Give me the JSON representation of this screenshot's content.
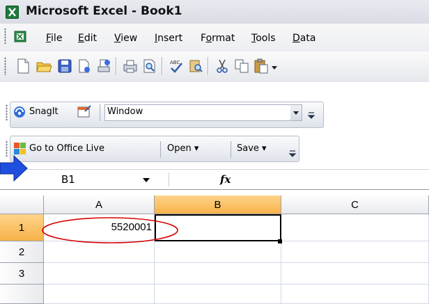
{
  "title_bar": {
    "title": "Microsoft Excel - Book1"
  },
  "menu": {
    "items": [
      {
        "label": "File",
        "underline": "F",
        "rest": "ile"
      },
      {
        "label": "Edit",
        "underline": "E",
        "rest": "dit"
      },
      {
        "label": "View",
        "underline": "V",
        "rest": "iew"
      },
      {
        "label": "Insert",
        "underline": "I",
        "rest": "nsert"
      },
      {
        "label": "Format",
        "pre": "F",
        "underline": "o",
        "rest": "rmat"
      },
      {
        "label": "Tools",
        "underline": "T",
        "rest": "ools"
      },
      {
        "label": "Data",
        "underline": "D",
        "rest": "ata"
      }
    ]
  },
  "standard_toolbar": {
    "icons": [
      "new-icon",
      "open-icon",
      "save-icon",
      "permission-icon",
      "print-area-icon",
      "print-icon",
      "print-preview-icon",
      "spelling-icon",
      "research-icon",
      "cut-icon",
      "copy-icon",
      "paste-icon"
    ]
  },
  "snagit_toolbar": {
    "label": "SnagIt",
    "combo_value": "Window"
  },
  "office_live_toolbar": {
    "go_label": "Go to Office Live",
    "open_label": "Open ▾",
    "save_label": "Save ▾"
  },
  "formula_bar": {
    "name_box": "B1",
    "fx": "fx",
    "formula": ""
  },
  "grid": {
    "columns": [
      "A",
      "B",
      "C"
    ],
    "rows": [
      "1",
      "2",
      "3"
    ],
    "cells": {
      "A1": "5520001",
      "B1": ""
    },
    "active_cell": "B1"
  },
  "colors": {
    "selected_header": "#f7b24a",
    "arrow": "#1f4fe0",
    "annotation_ellipse": "#d40000",
    "excel_green": "#1d7a3a"
  }
}
